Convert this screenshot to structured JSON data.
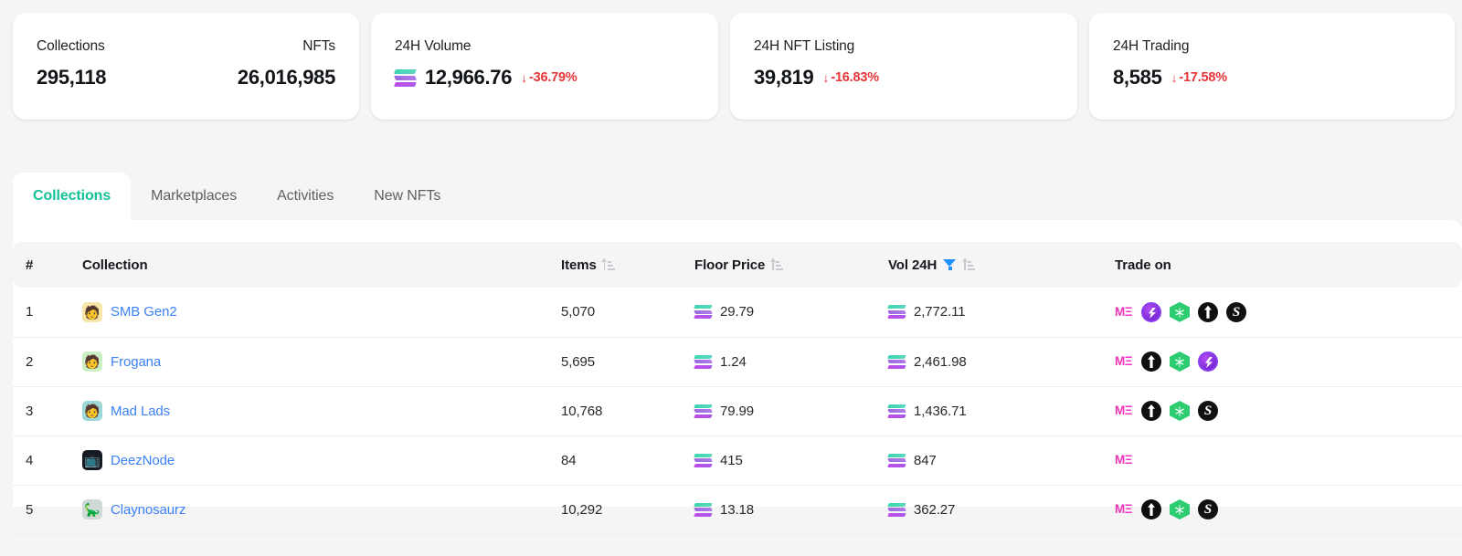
{
  "stats": [
    {
      "name": "collections-card",
      "left_label": "Collections",
      "left_value": "295,118",
      "right_label": "NFTs",
      "right_value": "26,016,985"
    },
    {
      "name": "volume-card",
      "label": "24H Volume",
      "value": "12,966.76",
      "delta": "-36.79%",
      "arrow": "↓",
      "currency_icon": "solana-icon"
    },
    {
      "name": "nft-listing-card",
      "label": "24H NFT Listing",
      "value": "39,819",
      "delta": "-16.83%",
      "arrow": "↓"
    },
    {
      "name": "trading-card",
      "label": "24H Trading",
      "value": "8,585",
      "delta": "-17.58%",
      "arrow": "↓"
    }
  ],
  "colors": {
    "accent_active_tab": "#13c296",
    "link": "#3b82f6",
    "negative": "#e8353a",
    "filter_active": "#1e90ff",
    "page_bg": "#f5f5f5"
  },
  "tabs": [
    {
      "label": "Collections",
      "active": true
    },
    {
      "label": "Marketplaces",
      "active": false
    },
    {
      "label": "Activities",
      "active": false
    },
    {
      "label": "New NFTs",
      "active": false
    }
  ],
  "table": {
    "headers": {
      "rank": "#",
      "collection": "Collection",
      "items": "Items",
      "floor_price": "Floor Price",
      "vol_24h": "Vol 24H",
      "trade_on": "Trade on"
    },
    "rows": [
      {
        "rank": "1",
        "collection": "SMB Gen2",
        "items": "5,070",
        "floor_price": "29.79",
        "vol_24h": "2,772.11",
        "avatar_bg": "#f7e6a8",
        "avatar_glyph": "🧑",
        "markets": [
          "magiceden",
          "tensor",
          "solanart",
          "hadeswap",
          "solsniper"
        ]
      },
      {
        "rank": "2",
        "collection": "Frogana",
        "items": "5,695",
        "floor_price": "1.24",
        "vol_24h": "2,461.98",
        "avatar_bg": "#c9efc2",
        "avatar_glyph": "🧑",
        "markets": [
          "magiceden",
          "hadeswap",
          "solanart",
          "tensor"
        ]
      },
      {
        "rank": "3",
        "collection": "Mad Lads",
        "items": "10,768",
        "floor_price": "79.99",
        "vol_24h": "1,436.71",
        "avatar_bg": "#9ed8d8",
        "avatar_glyph": "🧑",
        "markets": [
          "magiceden",
          "hadeswap",
          "solanart",
          "solsniper"
        ]
      },
      {
        "rank": "4",
        "collection": "DeezNode",
        "items": "84",
        "floor_price": "415",
        "vol_24h": "847",
        "avatar_bg": "#161a22",
        "avatar_glyph": "📺",
        "markets": [
          "magiceden"
        ]
      },
      {
        "rank": "5",
        "collection": "Claynosaurz",
        "items": "10,292",
        "floor_price": "13.18",
        "vol_24h": "362.27",
        "avatar_bg": "#cfd9d6",
        "avatar_glyph": "🦕",
        "markets": [
          "magiceden",
          "hadeswap",
          "solanart",
          "solsniper"
        ]
      }
    ]
  },
  "icons": {
    "sort": "sort-ascending-icon",
    "filter": "filter-funnel-icon",
    "magiceden_label": "MΞ"
  }
}
